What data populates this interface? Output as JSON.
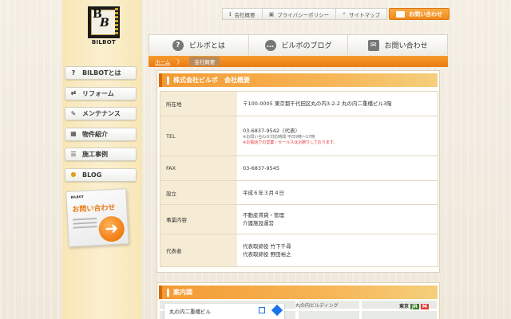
{
  "brand": {
    "logo_text": "BILBOT",
    "logo_letter": "B"
  },
  "top_links": [
    {
      "label": "会社概要",
      "icon": "info-icon"
    },
    {
      "label": "プライバシーポリシー",
      "icon": "lock-icon"
    },
    {
      "label": "サイトマップ",
      "icon": "search-icon"
    }
  ],
  "top_contact": {
    "label": "お問い合わせ",
    "icon": "mail-icon"
  },
  "main_nav": [
    {
      "label": "ビルボとは",
      "icon": "question-icon"
    },
    {
      "label": "ビルボのブログ",
      "icon": "speech-bubble-icon"
    },
    {
      "label": "お問い合わせ",
      "icon": "envelope-icon"
    }
  ],
  "breadcrumb": {
    "home": "ホーム",
    "separator": "〉",
    "current": "会社概要"
  },
  "side_nav": [
    {
      "label": "BILBOTとは",
      "icon": "question-icon"
    },
    {
      "label": "リフォーム",
      "icon": "arrows-icon"
    },
    {
      "label": "メンテナンス",
      "icon": "wrench-icon"
    },
    {
      "label": "物件紹介",
      "icon": "building-icon"
    },
    {
      "label": "施工事例",
      "icon": "list-icon"
    },
    {
      "label": "BLOG",
      "icon": "speech-bubble-icon"
    }
  ],
  "contact_card": {
    "brand": "BILBOT",
    "title": "お問い合わせ"
  },
  "company": {
    "heading": "株式会社ビルボ　会社概要",
    "rows": [
      {
        "label": "所在地",
        "lines": [
          "〒100-0005 東京都千代田区丸の内3-2-2 丸の内二重橋ビル3階"
        ],
        "notes": []
      },
      {
        "label": "TEL",
        "lines": [
          "03-6837-9542（代表）"
        ],
        "notes": [
          {
            "text": "※お問い合わせ対応時間 平日9時～17時",
            "style": "gray"
          },
          {
            "text": "※お電話での営業・セールスはお断りしております。",
            "style": "red"
          }
        ]
      },
      {
        "label": "FAX",
        "lines": [
          "03-6837-9545"
        ],
        "notes": []
      },
      {
        "label": "設立",
        "lines": [
          "平成６年３月４日"
        ],
        "notes": []
      },
      {
        "label": "事業内容",
        "lines": [
          "不動産賃貸・管理",
          "介護施設運営"
        ],
        "notes": []
      },
      {
        "label": "代表者",
        "lines": [
          "代表取締役 竹下千尋",
          "代表取締役 野田裕之"
        ],
        "notes": []
      }
    ]
  },
  "map": {
    "heading": "案内図",
    "place_name": "丸の内二重橋ビル",
    "map_label": "丸の内ビルディング",
    "station_label": "東京",
    "jr_label": "JR"
  },
  "colors": {
    "accent": "#f08a18",
    "panel_bg": "#fffdf8",
    "row_label_bg": "#f6ecd5"
  }
}
